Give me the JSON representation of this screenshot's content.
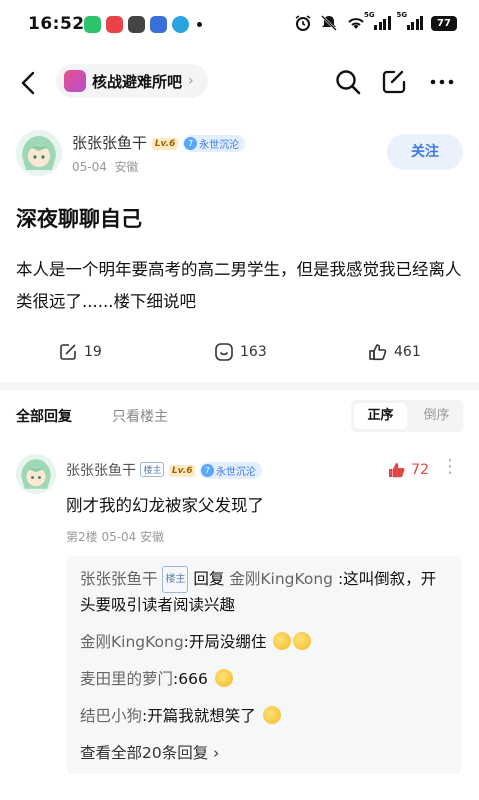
{
  "status_bar": {
    "time": "16:52",
    "network_tag_1": "5G",
    "network_tag_2": "5G",
    "battery": "77"
  },
  "nav": {
    "forum_name": "核战避难所吧",
    "forum_chevron": "›"
  },
  "author": {
    "name": "张张张鱼干",
    "level": "Lv.6",
    "medal_number": "7",
    "medal_text": "永世沉沦",
    "date": "05-04",
    "location": "安徽",
    "follow_label": "关注"
  },
  "post": {
    "title": "深夜聊聊自己",
    "body": "本人是一个明年要高考的高二男学生，但是我感觉我已经离人类很远了......楼下细说吧",
    "share_count": "19",
    "comment_count": "163",
    "like_count": "461"
  },
  "reply_tabs": {
    "all": "全部回复",
    "lz_only": "只看楼主",
    "sort_asc": "正序",
    "sort_desc": "倒序"
  },
  "comment": {
    "name": "张张张鱼干",
    "lz_badge": "楼主",
    "level": "Lv.6",
    "medal_number": "7",
    "medal_text": "永世沉沦",
    "likes": "72",
    "more": "⋮",
    "text": "刚才我的幻龙被家父发现了",
    "meta": "第2楼 05-04 安徽",
    "sub_replies": [
      {
        "who": "张张张鱼干",
        "badge": "楼主",
        "reply_word": "回复",
        "target": "金刚KingKong",
        "text": ":这叫倒叙，开头要吸引读者阅读兴趣"
      },
      {
        "who": "金刚KingKong",
        "text": ":开局没绷住"
      },
      {
        "who": "麦田里的萝门",
        "text": ":666"
      },
      {
        "who": "结巴小狗",
        "text": ":开篇我就想笑了"
      }
    ],
    "view_all": "查看全部20条回复 ›"
  },
  "colors": {
    "accent_blue": "#3b7be0",
    "like_red": "#e04848",
    "level_gold": "#a0620a"
  }
}
